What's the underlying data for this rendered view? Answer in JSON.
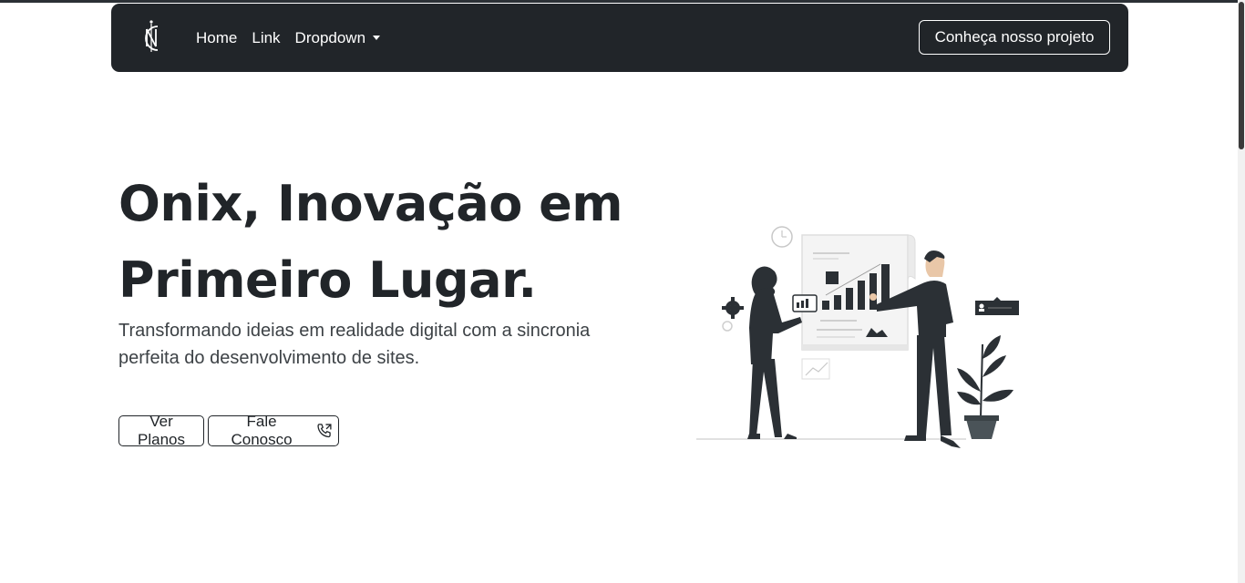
{
  "navbar": {
    "brand_icon": "onix-monogram-logo",
    "links": [
      "Home",
      "Link",
      "Dropdown"
    ],
    "cta_label": "Conheça nosso projeto"
  },
  "hero": {
    "title_line1": "Onix, Inovação em",
    "title_line2": "Primeiro Lugar.",
    "subtitle": "Transformando ideias em realidade digital com a sincronia perfeita do desenvolvimento de sites.",
    "buttons": {
      "plans_label": "Ver Planos",
      "contact_label": "Fale Conosco",
      "contact_icon": "phone-outgoing-icon"
    },
    "illustration": "business-growth-presentation"
  },
  "colors": {
    "navbar_bg": "#212529",
    "text": "#212529",
    "background": "#ffffff"
  }
}
